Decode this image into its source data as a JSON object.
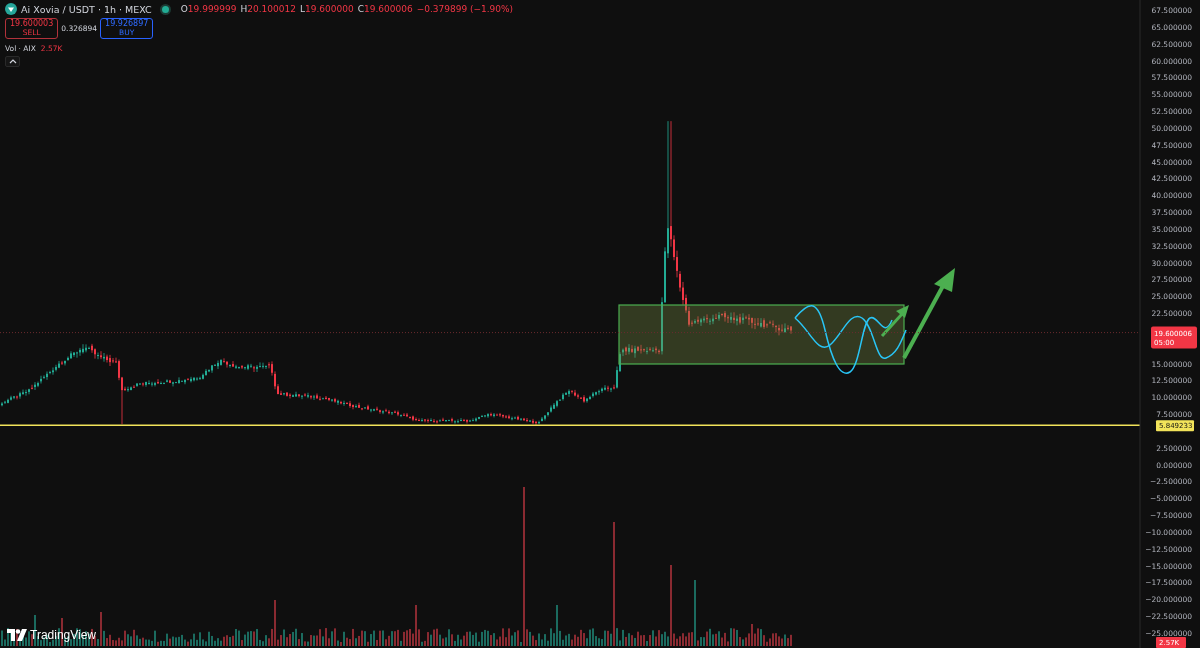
{
  "legend": {
    "symbol": "Ai Xovia / USDT · 1h · MEXC",
    "ohlc": [
      {
        "label": "O",
        "value": "19.999999"
      },
      {
        "label": "H",
        "value": "20.100012"
      },
      {
        "label": "L",
        "value": "19.600000"
      },
      {
        "label": "C",
        "value": "19.600006"
      }
    ],
    "change": "−0.379899 (−1.90%)"
  },
  "trade": {
    "sell": {
      "price": "19.600003",
      "label": "SELL"
    },
    "spread": "0.326894",
    "buy": {
      "price": "19.926897",
      "label": "BUY"
    }
  },
  "volume_legend": {
    "label": "Vol · AIX",
    "value": "2.57K"
  },
  "price_axis": {
    "ticks": [
      "67.500000",
      "65.000000",
      "62.500000",
      "60.000000",
      "57.500000",
      "55.000000",
      "52.500000",
      "50.000000",
      "47.500000",
      "45.000000",
      "42.500000",
      "40.000000",
      "37.500000",
      "35.000000",
      "32.500000",
      "30.000000",
      "27.500000",
      "25.000000",
      "22.500000",
      "15.000000",
      "12.500000",
      "10.000000",
      "7.500000",
      "2.500000",
      "0.000000",
      "−2.500000",
      "−5.000000",
      "−7.500000",
      "−10.000000",
      "−12.500000",
      "−15.000000",
      "−17.500000",
      "−20.000000",
      "−22.500000",
      "−25.000000"
    ]
  },
  "last_price": {
    "price": "19.600006",
    "countdown": "05:00"
  },
  "line_price": "5.849233",
  "volume_value": "2.57K",
  "brand": "TradingView"
}
